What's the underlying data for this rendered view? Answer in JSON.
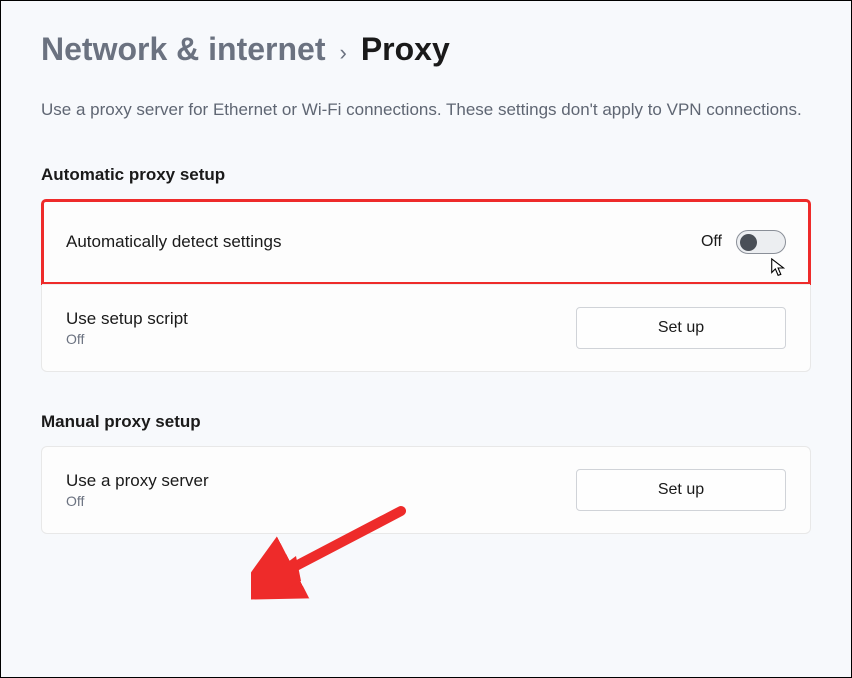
{
  "breadcrumb": {
    "parent": "Network & internet",
    "separator": "›",
    "current": "Proxy"
  },
  "description": "Use a proxy server for Ethernet or Wi-Fi connections. These settings don't apply to VPN connections.",
  "sections": {
    "auto": {
      "title": "Automatic proxy setup",
      "rows": {
        "detect": {
          "label": "Automatically detect settings",
          "toggle_state": "Off"
        },
        "script": {
          "label": "Use setup script",
          "status": "Off",
          "button": "Set up"
        }
      }
    },
    "manual": {
      "title": "Manual proxy setup",
      "rows": {
        "proxy": {
          "label": "Use a proxy server",
          "status": "Off",
          "button": "Set up"
        }
      }
    }
  }
}
